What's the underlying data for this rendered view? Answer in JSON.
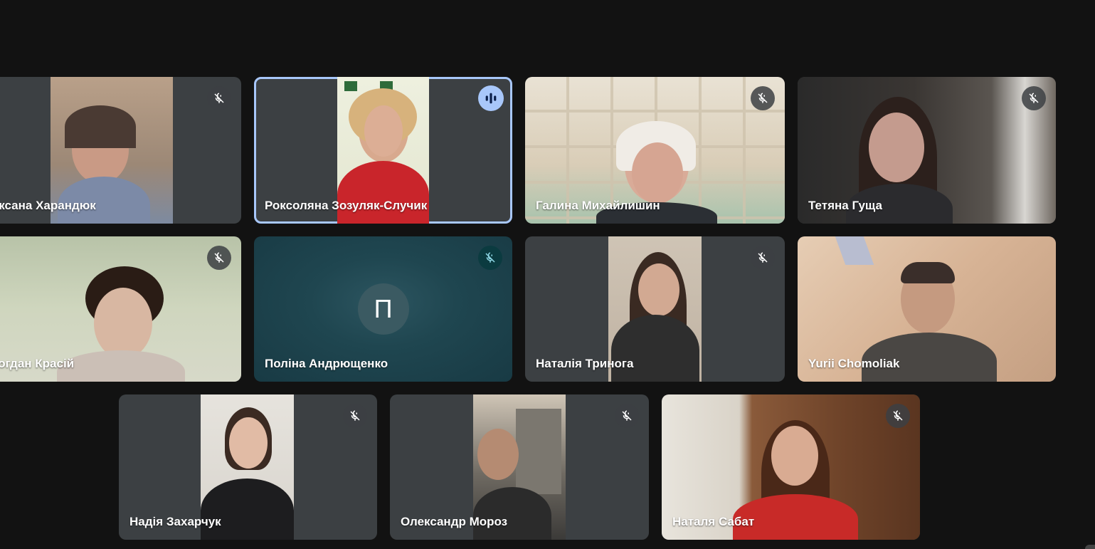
{
  "participants": [
    {
      "name": "Оксана Харандюк",
      "mic": "muted",
      "avatar_letter": ""
    },
    {
      "name": "Роксоляна Зозуляк-Случик",
      "mic": "speaking",
      "avatar_letter": ""
    },
    {
      "name": "Галина Михайлишин",
      "mic": "muted",
      "avatar_letter": ""
    },
    {
      "name": "Тетяна Гуща",
      "mic": "muted",
      "avatar_letter": ""
    },
    {
      "name": "Богдан Красій",
      "mic": "muted",
      "avatar_letter": ""
    },
    {
      "name": "Поліна Андрющенко",
      "mic": "muted",
      "avatar_letter": "П"
    },
    {
      "name": "Наталія Триногa",
      "mic": "muted",
      "avatar_letter": ""
    },
    {
      "name": "Yurii Chomoliak",
      "mic": "none",
      "avatar_letter": ""
    },
    {
      "name": "Надія Захарчук",
      "mic": "muted",
      "avatar_letter": ""
    },
    {
      "name": "Олександр Мороз",
      "mic": "muted",
      "avatar_letter": ""
    },
    {
      "name": "Наталя Сабат",
      "mic": "muted",
      "avatar_letter": ""
    }
  ],
  "icons": {
    "muted": "mic-off-icon",
    "speaking": "audio-level-icon"
  },
  "colors": {
    "background": "#121212",
    "tile": "#3c4043",
    "speaking_outline": "#a8c7fa",
    "avatar_tile": "#1f4c55"
  }
}
